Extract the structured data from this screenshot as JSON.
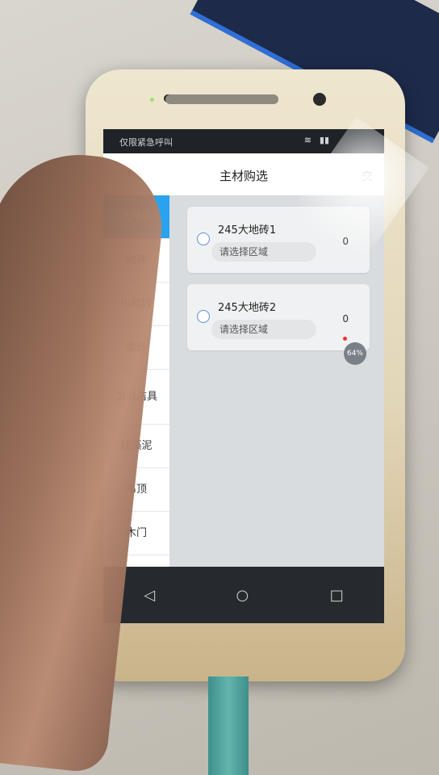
{
  "status": {
    "carrier": "仅限紧急呼叫",
    "wifi_icon": "wifi-icon",
    "signal_icon": "signal-icon"
  },
  "header": {
    "title": "主材购选",
    "submit": "交"
  },
  "categories": [
    {
      "label": "大地砖",
      "active": true
    },
    {
      "label": "地砖",
      "active": false
    },
    {
      "label": "小地砖",
      "active": false
    },
    {
      "label": "墙砖",
      "active": false
    },
    {
      "label": "卫浴洁具",
      "active": false
    },
    {
      "label": "硅藻泥",
      "active": false
    },
    {
      "label": "吊顶",
      "active": false
    },
    {
      "label": "木门",
      "active": false
    }
  ],
  "products": [
    {
      "name": "245大地砖1",
      "area_placeholder": "请选择区域",
      "qty": "0"
    },
    {
      "name": "245大地砖2",
      "area_placeholder": "请选择区域",
      "qty": "0"
    }
  ],
  "float_badge": "64%",
  "colors": {
    "accent": "#29a3ee"
  }
}
